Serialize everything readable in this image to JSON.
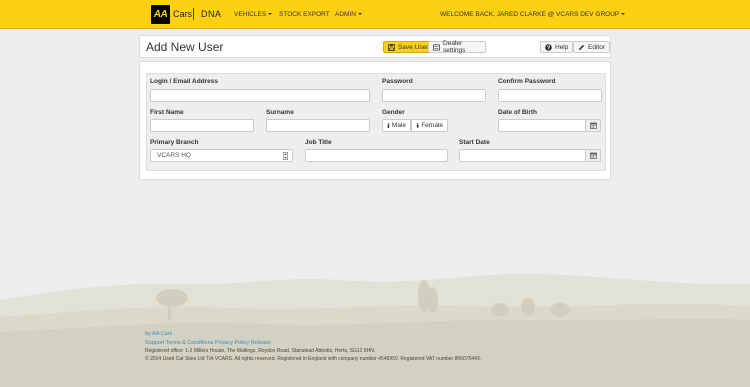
{
  "brand": {
    "logo": "AA",
    "cars": "Cars",
    "dna": "DNA"
  },
  "nav": {
    "vehicles": "VEHICLES",
    "stock_export": "STOCK EXPORT",
    "admin": "ADMIN",
    "welcome": "WELCOME BACK, JARED CLARKE @ VCARS DEV GROUP"
  },
  "header": {
    "title": "Add New User",
    "save_label": "Save User",
    "dealer_settings_label": "Dealer settings",
    "help_label": "Help",
    "editor_label": "Editor"
  },
  "form": {
    "login_label": "Login / Email Address",
    "login_value": "",
    "password_label": "Password",
    "confirm_password_label": "Confirm Password",
    "first_name_label": "First Name",
    "surname_label": "Surname",
    "gender_label": "Gender",
    "gender_options": [
      "Male",
      "Female"
    ],
    "dob_label": "Date of Birth",
    "primary_branch_label": "Primary Branch",
    "primary_branch_value": "VCARS HQ",
    "job_title_label": "Job Title",
    "start_date_label": "Start Date"
  },
  "footer": {
    "by_link": "by AA Cars",
    "support_link": "Support",
    "terms_link": "Terms & Conditions",
    "privacy_link": "Privacy Policy",
    "release_link": "Release",
    "registered_office": "Registered office: 1-2 Millers House, The Maltings, Roydon Road, Stanstead Abbotts, Herts, SG12 8HN.",
    "copyright_prefix": "© 2014 Used Car Sites Ltd T/A VCARS. All rights reserved. Registered in England with company number ",
    "company_number": "4546950",
    "vat_prefix": ". Registered VAT number ",
    "vat_number": "806075443",
    "copyright_suffix": "."
  },
  "colors": {
    "brand_yellow": "#fdd012",
    "link_blue": "#3a8dc6"
  }
}
